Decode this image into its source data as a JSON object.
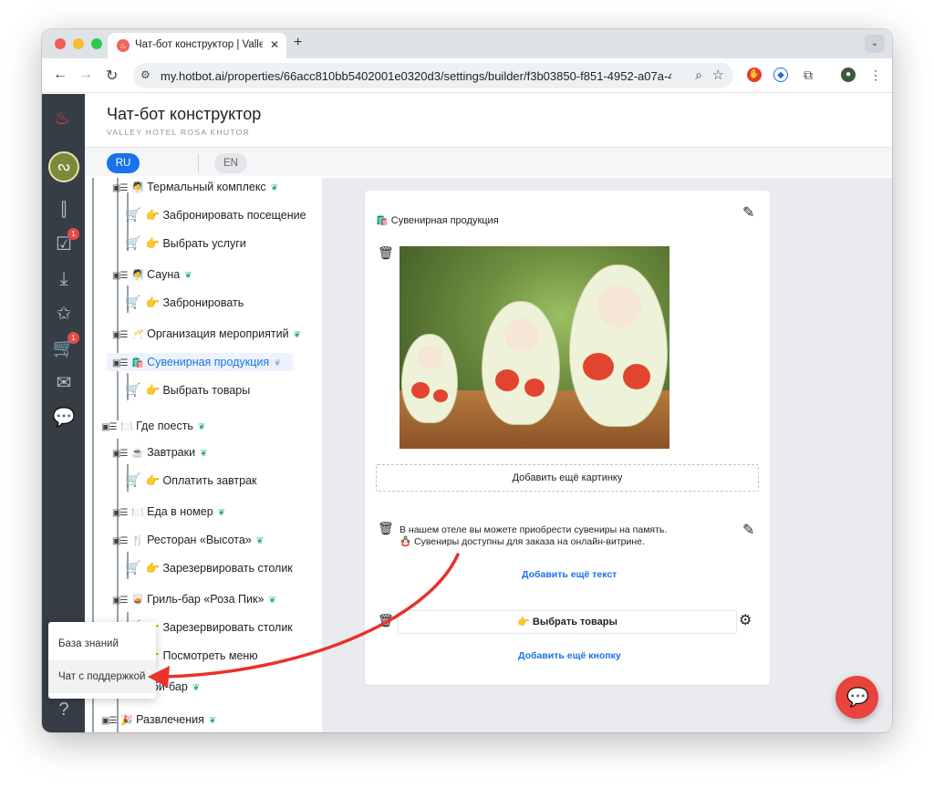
{
  "browser": {
    "tab_title": "Чат-бот конструктор | Valley",
    "tab_close": "✕",
    "new_tab": "+",
    "tab_menu": "⌄",
    "url": "my.hotbot.ai/properties/66acc810bb5402001e0320d3/settings/builder/f3b03850-f851-4952-a07a-4...",
    "icons": [
      "back-icon",
      "forward-icon",
      "reload-icon",
      "site-settings-icon",
      "zoom-icon",
      "bookmark-star-icon",
      "extension-icon",
      "profile-icon",
      "menu-icon"
    ]
  },
  "header": {
    "title": "Чат-бот конструктор",
    "subtitle": "VALLEY HOTEL ROSA KHUTOR",
    "langs": [
      "RU",
      "EN"
    ],
    "active_lang_color": "#1a73e8"
  },
  "sidebar": {
    "badges": [
      "1",
      "1"
    ]
  },
  "tree": {
    "items": [
      {
        "emoji": "🧖",
        "label": "Термальный комплекс"
      },
      {
        "label": "👉 Забронировать посещение"
      },
      {
        "label": "👉 Выбрать услуги"
      },
      {
        "emoji": "🧖",
        "label": "Сауна"
      },
      {
        "label": "👉 Забронировать"
      },
      {
        "emoji": "🥂",
        "label": "Организация мероприятий"
      },
      {
        "emoji": "🛍️",
        "label": "Сувенирная продукция"
      },
      {
        "label": "👉 Выбрать товары"
      },
      {
        "emoji": "🍽️",
        "label": "Где поесть"
      },
      {
        "emoji": "☕",
        "label": "Завтраки"
      },
      {
        "label": "👉 Оплатить завтрак"
      },
      {
        "emoji": "🍽️",
        "label": "Еда в номер"
      },
      {
        "emoji": "🍴",
        "label": "Ресторан «Высота»"
      },
      {
        "label": "👉 Зарезервировать столик"
      },
      {
        "emoji": "🥃",
        "label": "Гриль-бар «Роза Пик»"
      },
      {
        "label": "👉 Зарезервировать столик"
      },
      {
        "label": "👉 Посмотреть меню"
      },
      {
        "label": "Лобби-бар"
      },
      {
        "emoji": "🎉",
        "label": "Развлечения"
      }
    ]
  },
  "editor": {
    "title": "🛍️ Сувенирная продукция",
    "add_image": "Добавить ещё картинку",
    "text_line1": "В нашем отеле вы можете приобрести сувениры на память.",
    "text_line2": "🪆 Сувениры доступны для заказа на онлайн-витрине.",
    "add_text": "Добавить ещё текст",
    "button_label": "👉 Выбрать товары",
    "add_button": "Добавить ещё кнопку"
  },
  "popup": {
    "items": [
      "База знаний",
      "Чат с поддержкой"
    ]
  },
  "colors": {
    "accent": "#1a73e8",
    "brand_red": "#e8433d",
    "sidebar_bg": "#373d45",
    "knowledge_green": "#2fb36a"
  }
}
